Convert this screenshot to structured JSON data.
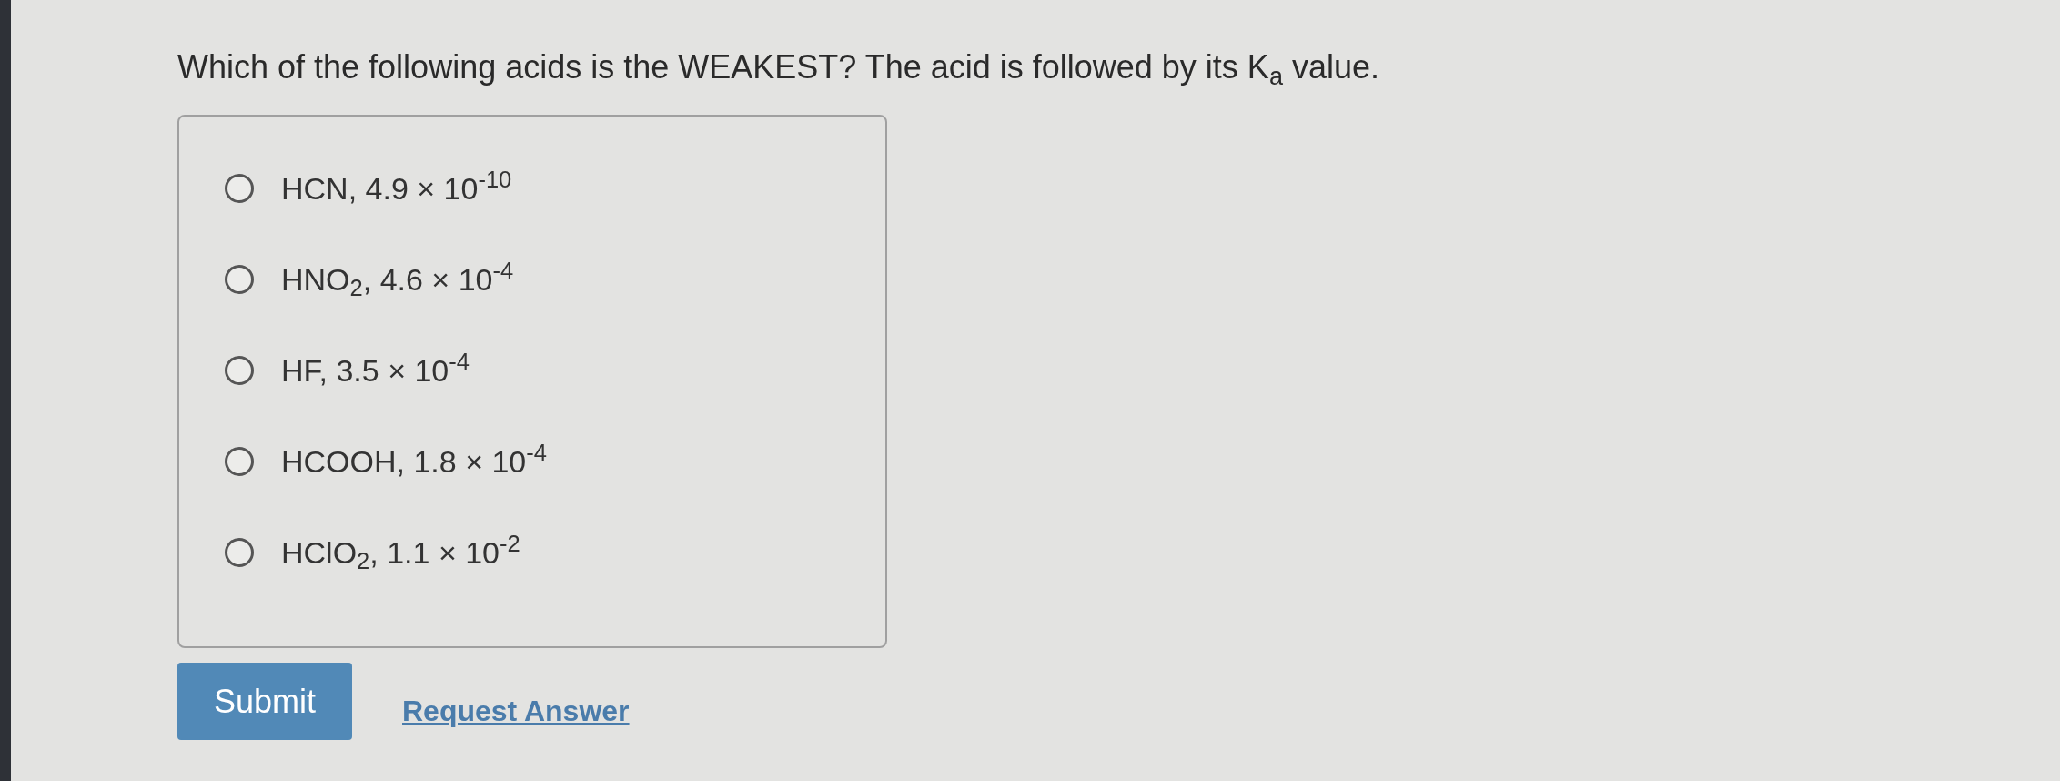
{
  "question": "Which of the following acids is the WEAKEST? The acid is followed by its K$_{a}$ value.",
  "options": [
    {
      "label": "HCN, 4.9 × 10$^{-10}$",
      "selected": false
    },
    {
      "label": "HNO$_{2}$, 4.6 × 10$^{-4}$",
      "selected": false
    },
    {
      "label": "HF, 3.5 × 10$^{-4}$",
      "selected": false
    },
    {
      "label": "HCOOH, 1.8 × 10$^{-4}$",
      "selected": false
    },
    {
      "label": "HClO$_{2}$, 1.1 × 10$^{-2}$",
      "selected": false
    }
  ],
  "submit_button": "Submit",
  "request_answer_link": "Request Answer"
}
